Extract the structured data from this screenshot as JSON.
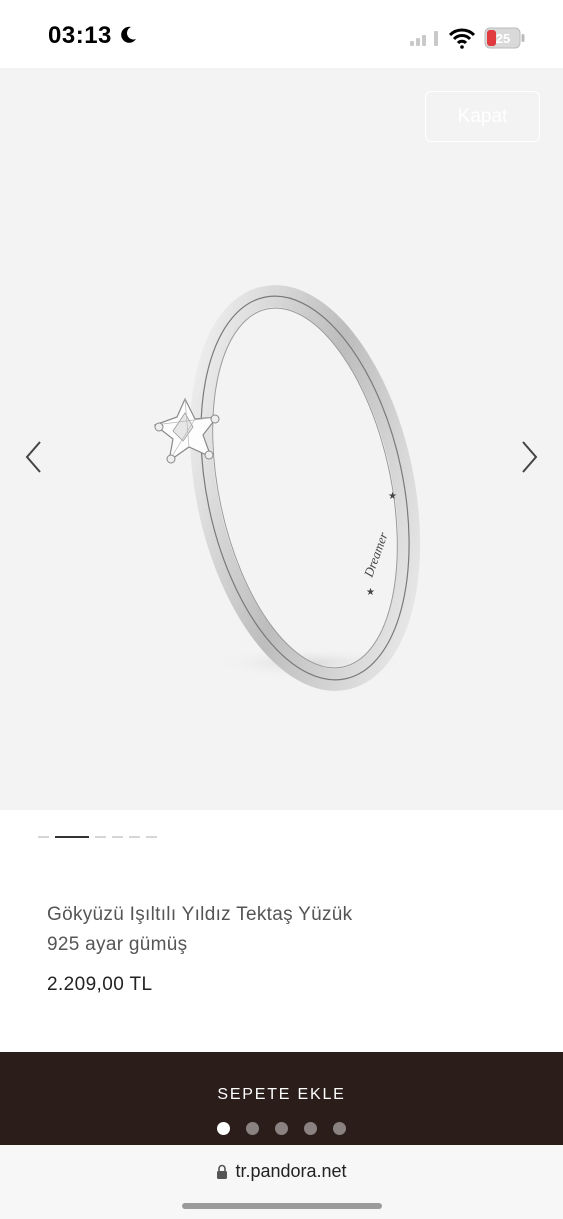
{
  "status_bar": {
    "time": "03:13",
    "battery": "25"
  },
  "gallery": {
    "close_label": "Kapat",
    "thumbnail_count": 6,
    "active_thumbnail": 2,
    "engraving": "Dreamer"
  },
  "product": {
    "name": "Gökyüzü Işıltılı Yıldız Tektaş Yüzük",
    "material": "925 ayar gümüş",
    "price": "2.209,00 TL"
  },
  "cart": {
    "add_label": "SEPETE EKLE",
    "pager_count": 5,
    "pager_active": 1
  },
  "browser": {
    "url": "tr.pandora.net"
  },
  "colors": {
    "cart_bar": "#2a1d1a",
    "gallery_bg": "#f3f3f3"
  }
}
